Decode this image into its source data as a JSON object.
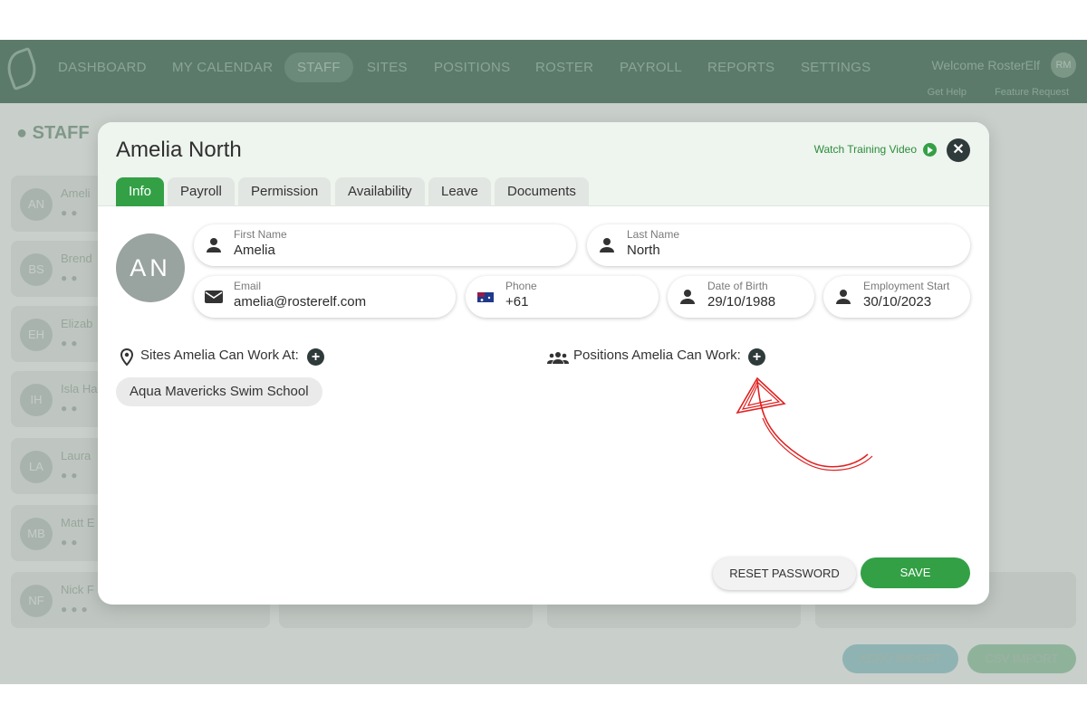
{
  "topnav": {
    "items": [
      "DASHBOARD",
      "MY CALENDAR",
      "STAFF",
      "SITES",
      "POSITIONS",
      "ROSTER",
      "PAYROLL",
      "REPORTS",
      "SETTINGS"
    ],
    "welcome": "Welcome RosterElf",
    "user_initials": "RM",
    "get_help": "Get Help",
    "feature_request": "Feature Request"
  },
  "background": {
    "header": "STAFF",
    "cards": [
      {
        "initials": "AN",
        "name": "Ameli"
      },
      {
        "initials": "BS",
        "name": "Brend"
      },
      {
        "initials": "EH",
        "name": "Elizab"
      },
      {
        "initials": "IH",
        "name": "Isla Ha"
      },
      {
        "initials": "LA",
        "name": "Laura"
      },
      {
        "initials": "MB",
        "name": "Matt E"
      },
      {
        "initials": "NF",
        "name": "Nick F"
      }
    ],
    "xero_import": "XERO IMPORT",
    "csv_import": "CSV IMPORT"
  },
  "modal": {
    "title": "Amelia North",
    "watch_video": "Watch Training Video",
    "tabs": [
      "Info",
      "Payroll",
      "Permission",
      "Availability",
      "Leave",
      "Documents"
    ],
    "active_tab": "Info",
    "avatar_initials": "AN",
    "fields": {
      "first_name": {
        "label": "First Name",
        "value": "Amelia"
      },
      "last_name": {
        "label": "Last Name",
        "value": "North"
      },
      "email": {
        "label": "Email",
        "value": "amelia@rosterelf.com"
      },
      "phone": {
        "label": "Phone",
        "value": "+61"
      },
      "dob": {
        "label": "Date of Birth",
        "value": "29/10/1988"
      },
      "employment_start": {
        "label": "Employment Start",
        "value": "30/10/2023"
      }
    },
    "sites_label": "Sites Amelia Can Work At:",
    "positions_label": "Positions Amelia Can Work:",
    "sites": [
      "Aqua Mavericks Swim School"
    ],
    "reset_password": "RESET PASSWORD",
    "save": "SAVE"
  },
  "colors": {
    "accent": "#33a046",
    "nav_bg": "#5c7a6a",
    "annotation": "#e02020"
  }
}
